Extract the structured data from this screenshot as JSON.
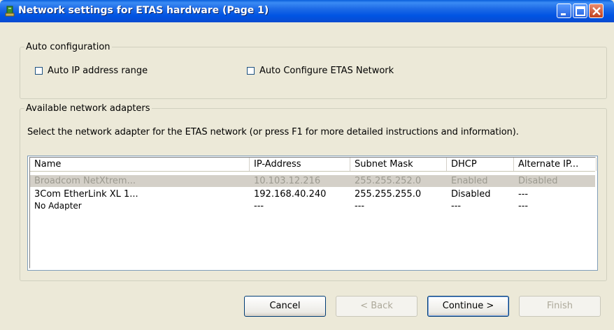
{
  "window": {
    "title": "Network settings for ETAS hardware (Page 1)",
    "controls": [
      "minimize-icon",
      "maximize-icon",
      "close-icon"
    ]
  },
  "auto_config": {
    "legend": "Auto configuration",
    "auto_ip_label": "Auto IP address range",
    "auto_ip_checked": false,
    "auto_etas_label": "Auto Configure ETAS Network",
    "auto_etas_checked": false
  },
  "adapters": {
    "legend": "Available network adapters",
    "instruction": "Select the network adapter for the ETAS network (or press F1 for more detailed instructions and information).",
    "columns": [
      "Name",
      "IP-Address",
      "Subnet Mask",
      "DHCP",
      "Alternate IP..."
    ],
    "rows": [
      [
        "Broadcom NetXtrem...",
        "10.103.12.216",
        "255.255.252.0",
        "Enabled",
        "Disabled"
      ],
      [
        "3Com EtherLink XL 1...",
        "192.168.40.240",
        "255.255.255.0",
        "Disabled",
        "---"
      ],
      [
        "No Adapter",
        "---",
        "---",
        "---",
        "---"
      ]
    ]
  },
  "buttons": {
    "cancel": "Cancel",
    "back": "< Back",
    "continue": "Continue >",
    "finish": "Finish"
  },
  "colors": {
    "titlebar": "#0054E3",
    "dialog_bg": "#ECE9D8",
    "selected_row": "#D4D0C8"
  }
}
